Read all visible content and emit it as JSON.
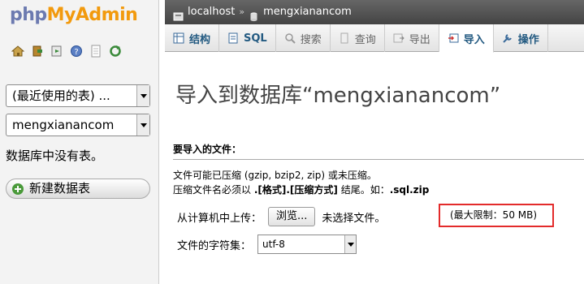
{
  "left": {
    "logo_php": "php",
    "logo_myadmin": "MyAdmin",
    "nav_icons": [
      "home-icon",
      "exit-icon",
      "sql-query-icon",
      "help-icon",
      "docs-icon",
      "reload-icon"
    ],
    "recent_select": "(最近使用的表) ...",
    "db_select": "mengxianancom",
    "no_tables": "数据库中没有表。",
    "new_table": "新建数据表"
  },
  "breadcrumb": {
    "server": "localhost",
    "separator": "»",
    "database": "mengxianancom"
  },
  "tabs": [
    {
      "label": "结构",
      "icon": "structure-icon",
      "state": "normal"
    },
    {
      "label": "SQL",
      "icon": "sql-icon",
      "state": "normal"
    },
    {
      "label": "搜索",
      "icon": "search-icon",
      "state": "disabled"
    },
    {
      "label": "查询",
      "icon": "query-icon",
      "state": "disabled"
    },
    {
      "label": "导出",
      "icon": "export-icon",
      "state": "disabled"
    },
    {
      "label": "导入",
      "icon": "import-icon",
      "state": "active"
    },
    {
      "label": "操作",
      "icon": "operations-icon",
      "state": "normal"
    }
  ],
  "main": {
    "title": "导入到数据库“mengxianancom”",
    "section_head": "要导入的文件：",
    "note1": "文件可能已压缩 (gzip, bzip2, zip) 或未压缩。",
    "note2_prefix": "压缩文件名必须以 ",
    "note2_format": ".[格式].[压缩方式]",
    "note2_mid": " 结尾。如：",
    "note2_example": ".sql.zip",
    "upload_label": "从计算机中上传：",
    "browse_button": "浏览...",
    "no_file": "未选择文件。",
    "max_limit": "(最大限制：50 MB)",
    "charset_label": "文件的字符集：",
    "charset_value": "utf-8"
  },
  "colors": {
    "logo_php": "#6c7ab0",
    "logo_myadmin": "#f29a0e",
    "tab_link": "#235a81",
    "highlight_border": "#e32b2b"
  }
}
